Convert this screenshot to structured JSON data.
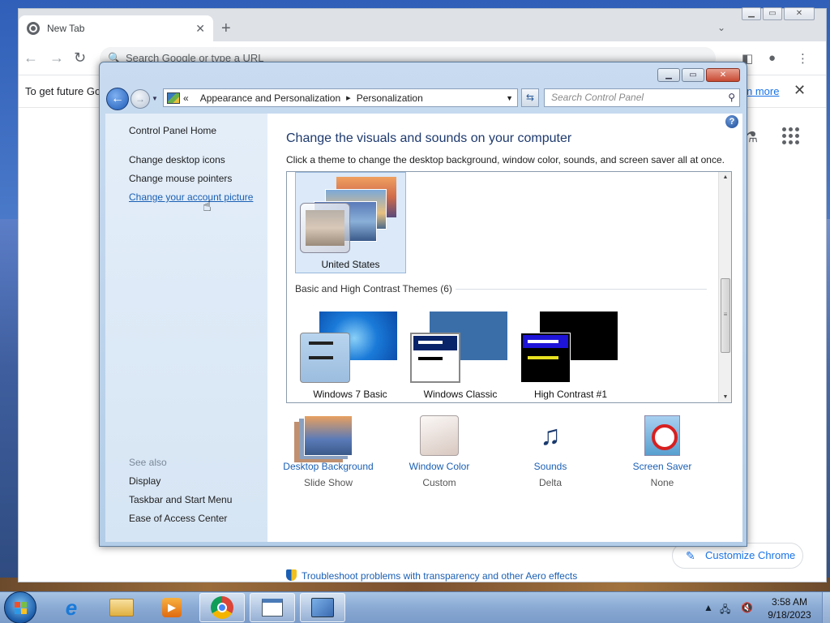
{
  "chrome": {
    "tab_title": "New Tab",
    "new_tab": "+",
    "omnibox_placeholder": "Search Google or type a URL",
    "infobar_message": "To get future Go",
    "infobar_link": "n more",
    "customize_label": "Customize Chrome"
  },
  "control_panel": {
    "address": {
      "overflow": "«",
      "crumb1": "Appearance and Personalization",
      "separator": "▸",
      "crumb2": "Personalization"
    },
    "search_placeholder": "Search Control Panel",
    "sidebar": {
      "home": "Control Panel Home",
      "links": [
        "Change desktop icons",
        "Change mouse pointers",
        "Change your account picture"
      ],
      "see_also_label": "See also",
      "see_also": [
        "Display",
        "Taskbar and Start Menu",
        "Ease of Access Center"
      ]
    },
    "heading": "Change the visuals and sounds on your computer",
    "subtext": "Click a theme to change the desktop background, window color, sounds, and screen saver all at once.",
    "selected_theme": "United States",
    "group_header": "Basic and High Contrast Themes (6)",
    "themes": [
      "Windows 7 Basic",
      "Windows Classic",
      "High Contrast #1"
    ],
    "bottom": [
      {
        "title": "Desktop Background",
        "value": "Slide Show",
        "icon": "desktop-background-icon"
      },
      {
        "title": "Window Color",
        "value": "Custom",
        "icon": "window-color-icon"
      },
      {
        "title": "Sounds",
        "value": "Delta",
        "icon": "sounds-icon"
      },
      {
        "title": "Screen Saver",
        "value": "None",
        "icon": "screen-saver-icon"
      }
    ],
    "troubleshoot": "Troubleshoot problems with transparency and other Aero effects"
  },
  "taskbar": {
    "time": "3:58 AM",
    "date": "9/18/2023"
  }
}
